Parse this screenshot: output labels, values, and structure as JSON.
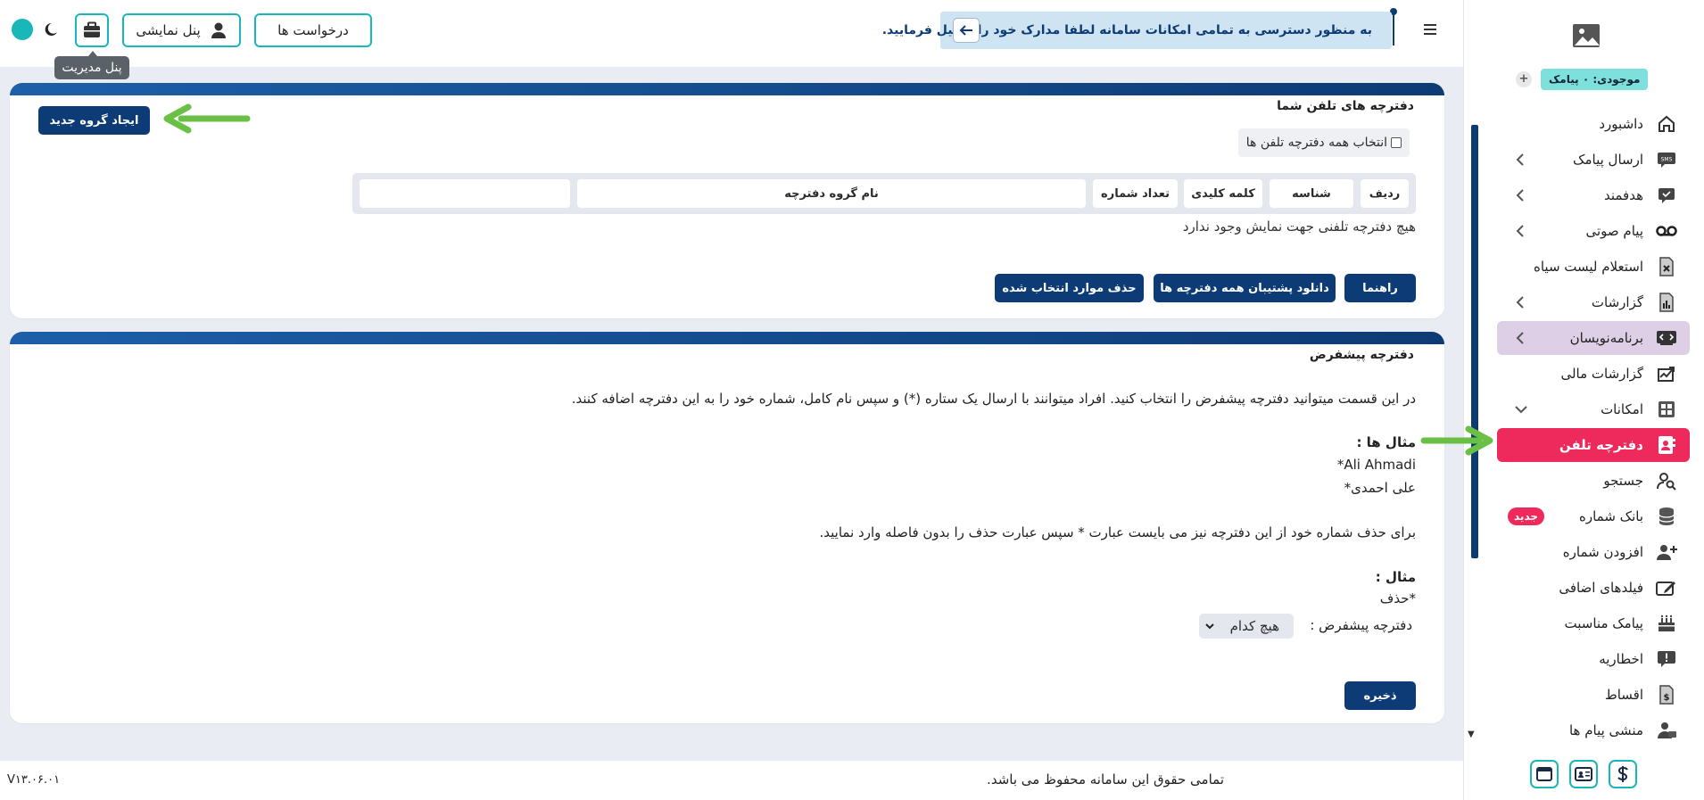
{
  "topbar": {
    "alert_text": "به منظور دسترسی به تمامی امکانات سامانه لطفا مدارک خود را تکمیل فرمایید.",
    "requests_label": "درخواست ها",
    "demo_panel_label": "پنل نمایشی",
    "admin_tooltip": "پنل مدیریت"
  },
  "sidebar": {
    "credit": "موجودی: ۰ پیامک",
    "items": [
      {
        "label": "داشبورد",
        "icon": "home-icon"
      },
      {
        "label": "ارسال پیامک",
        "icon": "sms-icon"
      },
      {
        "label": "هدفمند",
        "icon": "chat-icon"
      },
      {
        "label": "پیام صوتی",
        "icon": "voicemail-icon"
      },
      {
        "label": "استعلام لیست سیاه",
        "icon": "blacklist-icon"
      },
      {
        "label": "گزارشات",
        "icon": "report-icon"
      },
      {
        "label": "برنامه‌نویسان",
        "icon": "code-icon"
      },
      {
        "label": "گزارشات مالی",
        "icon": "finance-chart-icon"
      },
      {
        "label": "امکانات",
        "icon": "features-icon"
      },
      {
        "label": "دفترچه تلفن",
        "icon": "phonebook-icon"
      },
      {
        "label": "جستجو",
        "icon": "user-search-icon"
      },
      {
        "label": "بانک شماره",
        "icon": "database-icon",
        "badge": "جدید"
      },
      {
        "label": "افزودن شماره",
        "icon": "user-add-icon"
      },
      {
        "label": "فیلدهای اضافی",
        "icon": "edit-field-icon"
      },
      {
        "label": "پیامک مناسبت",
        "icon": "cake-icon"
      },
      {
        "label": "اخطاریه",
        "icon": "warning-icon"
      },
      {
        "label": "اقساط",
        "icon": "installment-icon"
      },
      {
        "label": "منشی پیام ها",
        "icon": "secretary-icon"
      }
    ],
    "footer_buttons": [
      "window-icon",
      "contact-card-icon",
      "dollar-icon"
    ]
  },
  "phonebooks": {
    "title": "دفترچه های تلفن شما",
    "new_group_button": "ایجاد گروه جدید",
    "select_all_label": "انتخاب همه دفترچه تلفن ها",
    "columns": [
      "ردیف",
      "شناسه",
      "کلمه کلیدی",
      "تعداد شماره",
      "نام گروه دفترچه",
      ""
    ],
    "empty_message": "هیچ دفترچه تلفنی جهت نمایش وجود ندارد",
    "help_button": "راهنما",
    "download_backup_button": "دانلود پشتیبان همه دفترچه ها",
    "delete_selected_button": "حذف موارد انتخاب شده"
  },
  "default_book": {
    "title": "دفترچه پیشفرض",
    "intro": "در این قسمت میتوانید دفترچه پیشفرض را انتخاب کنید. افراد میتوانند با ارسال یک ستاره (*) و سپس نام کامل، شماره خود را به این دفترچه اضافه کنند.",
    "examples_heading": "مثال ها :",
    "example_1": "*Ali Ahmadi",
    "example_2": "علی احمدی*",
    "delete_note": "برای حذف شماره خود از این دفترچه نیز می بایست عبارت * سپس عبارت حذف را بدون فاصله وارد نمایید.",
    "example_heading": "مثال :",
    "example_delete": "*حذف",
    "select_label": "دفترچه پیشفرض :",
    "select_value": "هیچ کدام",
    "save_button": "ذخیره"
  },
  "footer": {
    "rights": "تمامی حقوق این سامانه محفوظ می باشد.",
    "version": "V۱۳.۰۶.۰۱"
  },
  "colors": {
    "primary": "#0d3b75",
    "accent": "#1ab7b9",
    "active": "#ee2a5c",
    "arrow": "#6abf45"
  }
}
